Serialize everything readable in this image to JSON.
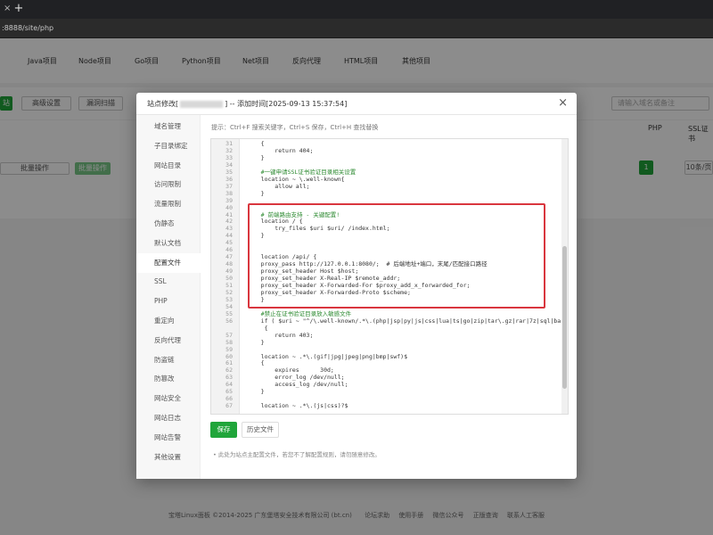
{
  "browser": {
    "tab_close": "×",
    "new_tab": "+",
    "url": ":8888/site/php"
  },
  "backdrop": {
    "tabs": [
      "Java项目",
      "Node项目",
      "Go项目",
      "Python项目",
      "Net项目",
      "反向代理",
      "HTML项目",
      "其他项目"
    ],
    "toolbar": {
      "add_site": "站",
      "advanced": "高级设置",
      "sync": "漏洞扫描",
      "batch": "批量操作",
      "batch_btn": "批量操作",
      "search_placeholder": "请输入域名或备注"
    },
    "table_headers": {
      "php": "PHP",
      "ssl": "SSL证书"
    },
    "pagination": {
      "page": "1",
      "per_page": "10条/页"
    },
    "footer": "宝塔Linux面板 ©2014-2025 广东堡塔安全技术有限公司 (bt.cn)",
    "footer_links": [
      "论坛求助",
      "使用手册",
      "微信公众号",
      "正版查询",
      "联系人工客服"
    ]
  },
  "modal": {
    "title_prefix": "站点修改[",
    "title_suffix": "] -- 添加时间[2025-09-13 15:37:54]",
    "close": "×",
    "hint": "提示：Ctrl+F 搜索关键字，Ctrl+S 保存，Ctrl+H 查找替换",
    "sidebar": [
      "域名管理",
      "子目录绑定",
      "网站目录",
      "访问限制",
      "流量限制",
      "伪静态",
      "默认文档",
      "配置文件",
      "SSL",
      "PHP",
      "重定向",
      "反向代理",
      "防盗链",
      "防篡改",
      "网站安全",
      "网站日志",
      "网站告警",
      "其他设置"
    ],
    "active_sidebar": "配置文件",
    "code_lines": [
      {
        "n": "31",
        "t": "    {",
        "c": ""
      },
      {
        "n": "32",
        "t": "        return 404;",
        "c": ""
      },
      {
        "n": "33",
        "t": "    }",
        "c": ""
      },
      {
        "n": "34",
        "t": "",
        "c": ""
      },
      {
        "n": "35",
        "t": "    #一键申请SSL证书验证目录相关设置",
        "c": "comment"
      },
      {
        "n": "36",
        "t": "    location ~ \\.well-known{",
        "c": ""
      },
      {
        "n": "37",
        "t": "        allow all;",
        "c": ""
      },
      {
        "n": "38",
        "t": "    }",
        "c": ""
      },
      {
        "n": "39",
        "t": "",
        "c": ""
      },
      {
        "n": "40",
        "t": "",
        "c": ""
      },
      {
        "n": "41",
        "t": "    # 前端路由支持 - 关键配置!",
        "c": "comment"
      },
      {
        "n": "42",
        "t": "    location / {",
        "c": ""
      },
      {
        "n": "43",
        "t": "        try_files $uri $uri/ /index.html;",
        "c": ""
      },
      {
        "n": "44",
        "t": "    }",
        "c": ""
      },
      {
        "n": "45",
        "t": "",
        "c": ""
      },
      {
        "n": "46",
        "t": "",
        "c": ""
      },
      {
        "n": "47",
        "t": "    location /api/ {",
        "c": ""
      },
      {
        "n": "48",
        "t": "    proxy_pass http://127.0.0.1:8080/;  # 后端地址+端口，末尾/匹配接口路径",
        "c": ""
      },
      {
        "n": "49",
        "t": "    proxy_set_header Host $host;",
        "c": ""
      },
      {
        "n": "50",
        "t": "    proxy_set_header X-Real-IP $remote_addr;",
        "c": ""
      },
      {
        "n": "51",
        "t": "    proxy_set_header X-Forwarded-For $proxy_add_x_forwarded_for;",
        "c": ""
      },
      {
        "n": "52",
        "t": "    proxy_set_header X-Forwarded-Proto $scheme;",
        "c": ""
      },
      {
        "n": "53",
        "t": "    }",
        "c": ""
      },
      {
        "n": "54",
        "t": "",
        "c": ""
      },
      {
        "n": "55",
        "t": "    #禁止在证书验证目录放入敏感文件",
        "c": "comment"
      },
      {
        "n": "56",
        "t": "    if ( $uri ~ \"^/\\.well-known/.*\\.(php|jsp|py|js|css|lua|ts|go|zip|tar\\.gz|rar|7z|sql|bak)$\" )",
        "c": ""
      },
      {
        "n": "",
        "t": "     {",
        "c": ""
      },
      {
        "n": "57",
        "t": "        return 403;",
        "c": ""
      },
      {
        "n": "58",
        "t": "    }",
        "c": ""
      },
      {
        "n": "59",
        "t": "",
        "c": ""
      },
      {
        "n": "60",
        "t": "    location ~ .*\\.(gif|jpg|jpeg|png|bmp|swf)$",
        "c": ""
      },
      {
        "n": "61",
        "t": "    {",
        "c": ""
      },
      {
        "n": "62",
        "t": "        expires      30d;",
        "c": ""
      },
      {
        "n": "63",
        "t": "        error_log /dev/null;",
        "c": ""
      },
      {
        "n": "64",
        "t": "        access_log /dev/null;",
        "c": ""
      },
      {
        "n": "65",
        "t": "    }",
        "c": ""
      },
      {
        "n": "66",
        "t": "",
        "c": ""
      },
      {
        "n": "67",
        "t": "    location ~ .*\\.(js|css)?$",
        "c": ""
      }
    ],
    "save_button": "保存",
    "history_button": "历史文件",
    "note": "此处为站点主配置文件，若您不了解配置规则，请勿随意修改。"
  }
}
